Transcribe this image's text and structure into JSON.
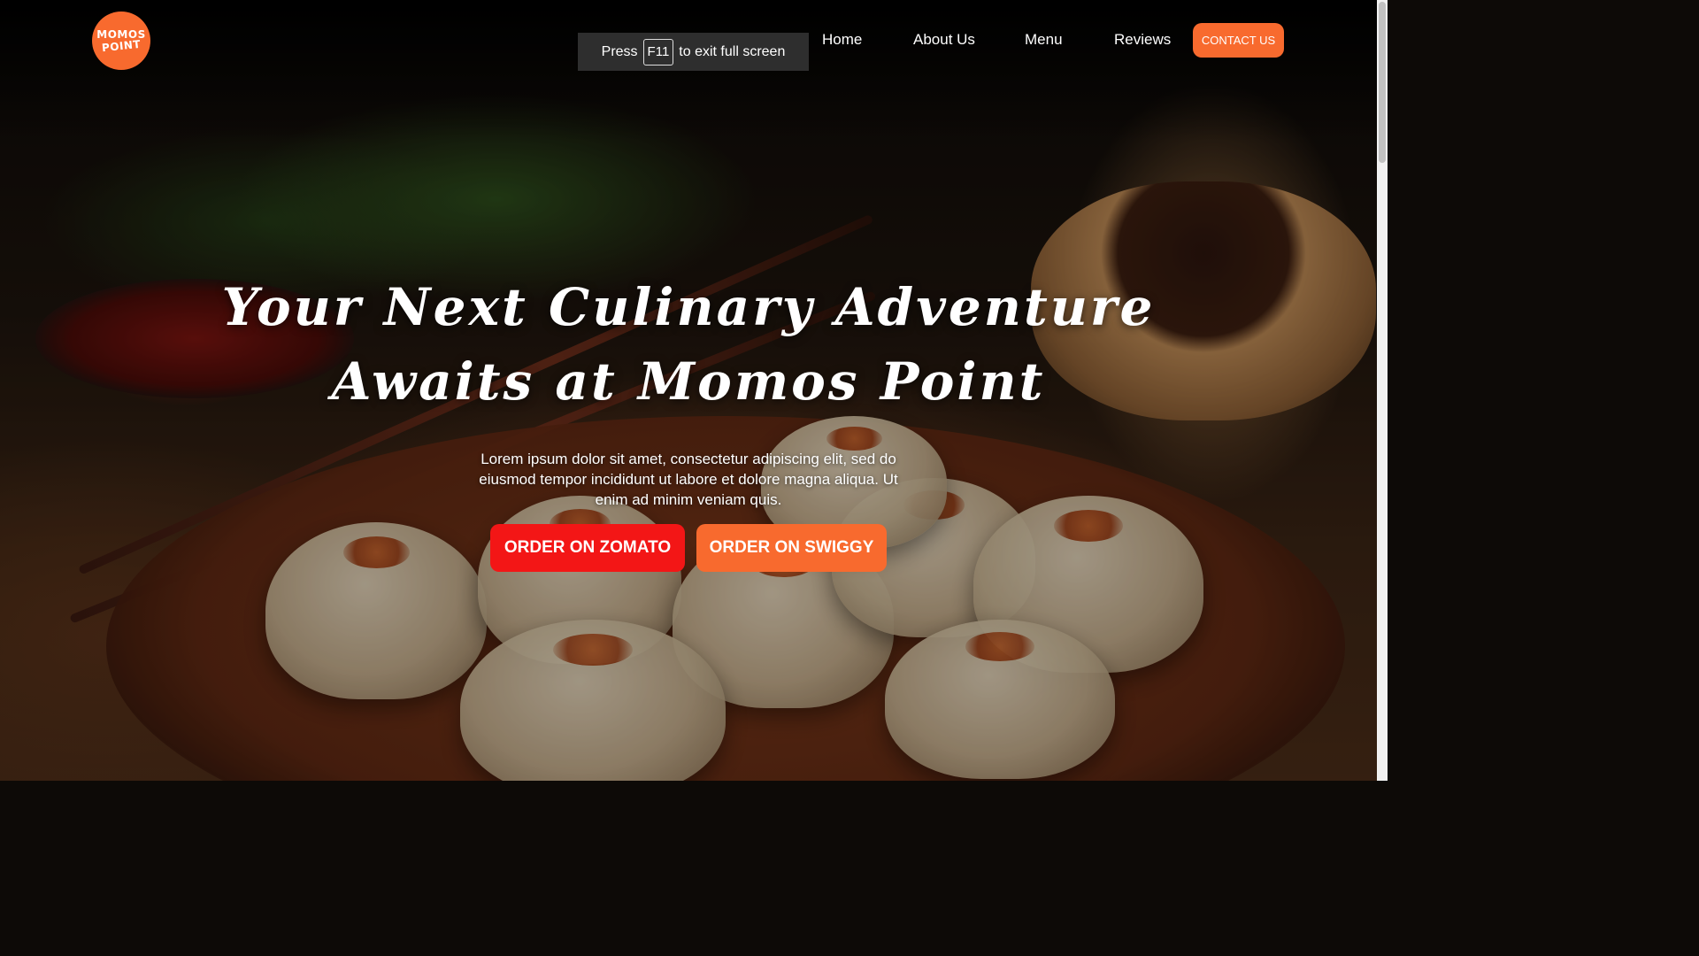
{
  "brand": {
    "logo_line1": "MOMOS",
    "logo_line2": "POINT",
    "accent_color": "#f86a2e",
    "zomato_color": "#f31616"
  },
  "nav": {
    "home": "Home",
    "about": "About Us",
    "menu": "Menu",
    "reviews": "Reviews",
    "contact": "CONTACT US"
  },
  "fullscreen_notice": {
    "prefix": "Press",
    "key": "F11",
    "suffix": "to exit full screen"
  },
  "hero": {
    "headline_line1": "Your Next Culinary Adventure",
    "headline_line2": "Awaits at Momos Point",
    "body": "Lorem ipsum dolor sit amet, consectetur adipiscing elit, sed do eiusmod tempor incididunt ut labore et dolore magna aliqua. Ut enim ad minim veniam quis.",
    "zomato_button": "ORDER ON ZOMATO",
    "swiggy_button": "ORDER ON SWIGGY"
  }
}
